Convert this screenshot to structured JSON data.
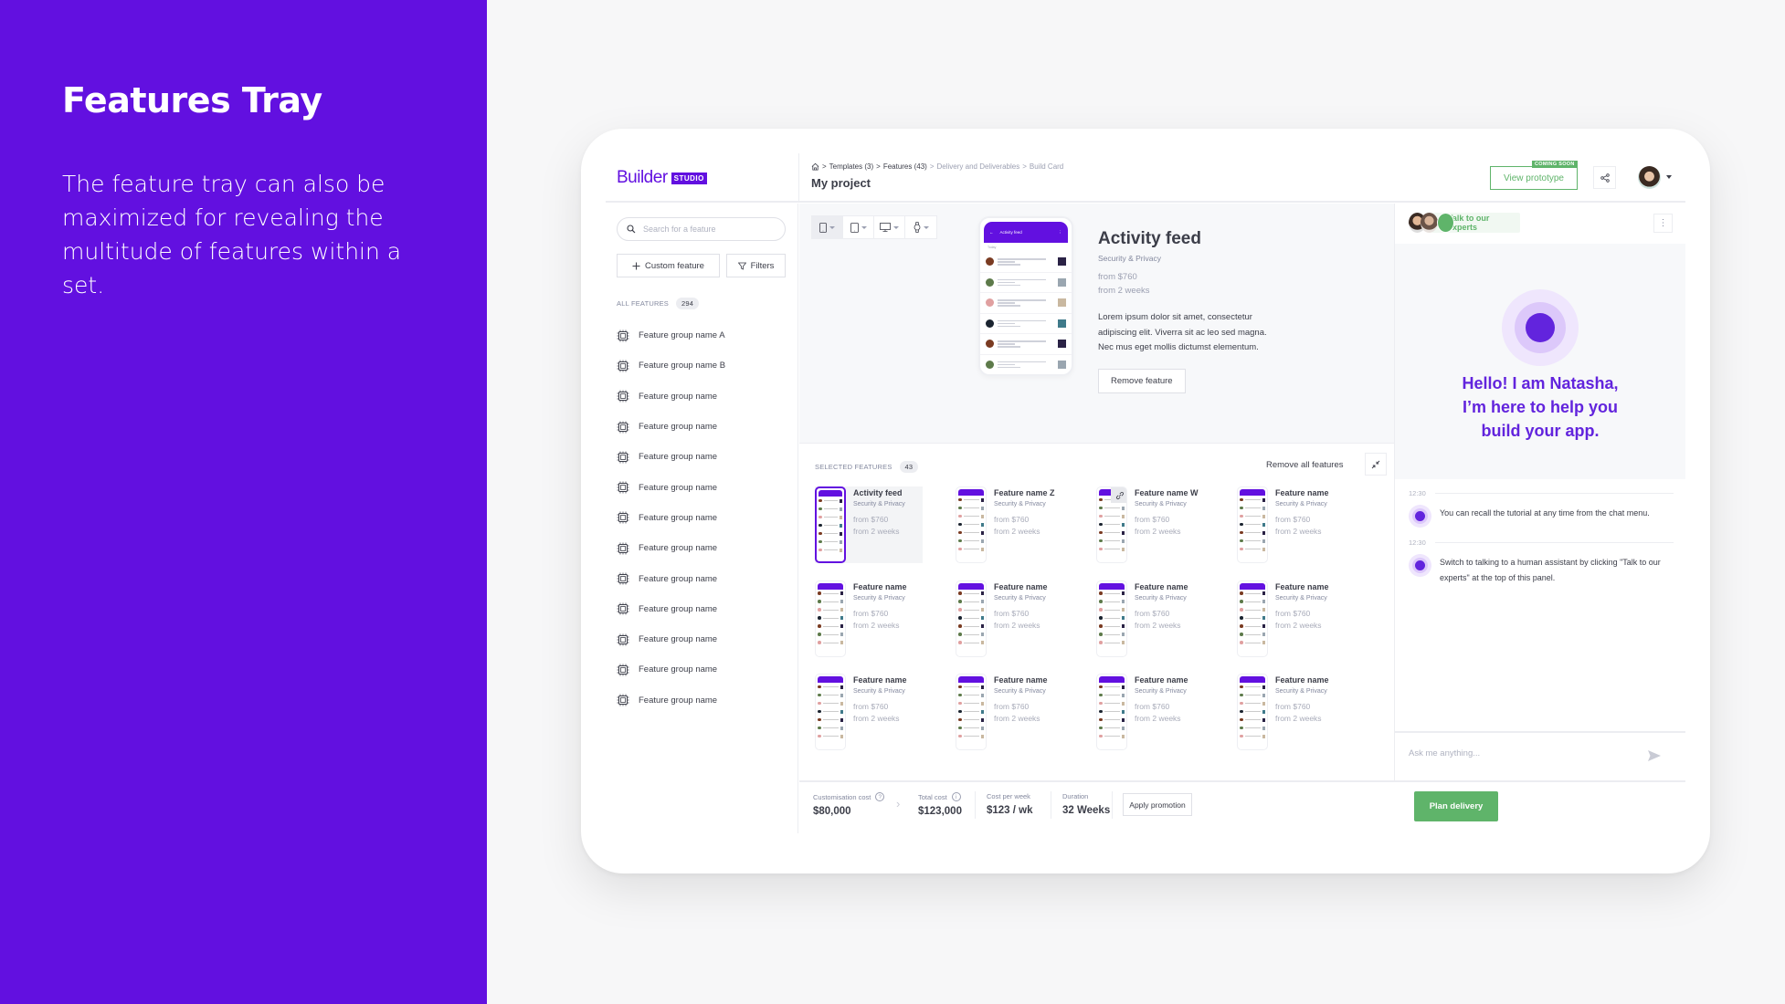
{
  "slide": {
    "title": "Features Tray",
    "description": "The feature tray can also be maximized for revealing the multitude of features within a set.",
    "accent": "#6210e0"
  },
  "app": {
    "logo": {
      "word": "Builder",
      "badge": "STUDIO"
    },
    "breadcrumb": {
      "home_icon": "home-icon",
      "items": [
        {
          "label": "Templates (3)",
          "active": true
        },
        {
          "label": "Features (43)",
          "active": true
        },
        {
          "label": "Delivery and Deliverables",
          "active": false
        },
        {
          "label": "Build Card",
          "active": false
        }
      ],
      "separator": ">"
    },
    "project_title": "My project",
    "header": {
      "view_prototype": "View prototype",
      "coming_soon": "COMING SOON",
      "share_icon": "share-icon"
    }
  },
  "sidebar": {
    "search_placeholder": "Search for a feature",
    "custom_feature": "Custom feature",
    "filters": "Filters",
    "all_features_label": "ALL FEATURES",
    "all_features_count": "294",
    "groups": [
      "Feature group name A",
      "Feature group name B",
      "Feature group name",
      "Feature group name",
      "Feature group name",
      "Feature group name",
      "Feature group name",
      "Feature group name",
      "Feature group name",
      "Feature group name",
      "Feature group name",
      "Feature group name",
      "Feature group name"
    ]
  },
  "preview": {
    "device_toggles": [
      {
        "icon": "mobile-icon",
        "active": true
      },
      {
        "icon": "tablet-icon",
        "active": false
      },
      {
        "icon": "desktop-icon",
        "active": false
      },
      {
        "icon": "watch-icon",
        "active": false
      }
    ],
    "phone_screen_title": "Activity feed",
    "phone_today": "Today",
    "feature": {
      "title": "Activity feed",
      "category": "Security & Privacy",
      "price": "from $760",
      "duration": "from 2 weeks",
      "description": "Lorem ipsum dolor sit amet, consectetur adipiscing elit. Viverra sit ac leo sed magna. Nec mus eget mollis dictumst elementum.",
      "remove_label": "Remove feature"
    }
  },
  "selected": {
    "label": "SELECTED FEATURES",
    "count": "43",
    "remove_all": "Remove all features",
    "cards": [
      {
        "name": "Activity feed",
        "category": "Security & Privacy",
        "price": "from $760",
        "duration": "from 2 weeks",
        "selected": true,
        "linked": false
      },
      {
        "name": "Feature name Z",
        "category": "Security & Privacy",
        "price": "from $760",
        "duration": "from 2 weeks",
        "selected": false,
        "linked": false
      },
      {
        "name": "Feature name W",
        "category": "Security & Privacy",
        "price": "from $760",
        "duration": "from 2 weeks",
        "selected": false,
        "linked": true
      },
      {
        "name": "Feature name",
        "category": "Security & Privacy",
        "price": "from $760",
        "duration": "from 2 weeks",
        "selected": false,
        "linked": false
      },
      {
        "name": "Feature name",
        "category": "Security & Privacy",
        "price": "from $760",
        "duration": "from 2 weeks",
        "selected": false,
        "linked": false
      },
      {
        "name": "Feature name",
        "category": "Security & Privacy",
        "price": "from $760",
        "duration": "from 2 weeks",
        "selected": false,
        "linked": false
      },
      {
        "name": "Feature name",
        "category": "Security & Privacy",
        "price": "from $760",
        "duration": "from 2 weeks",
        "selected": false,
        "linked": false
      },
      {
        "name": "Feature name",
        "category": "Security & Privacy",
        "price": "from $760",
        "duration": "from 2 weeks",
        "selected": false,
        "linked": false
      },
      {
        "name": "Feature name",
        "category": "Security & Privacy",
        "price": "from $760",
        "duration": "from 2 weeks",
        "selected": false,
        "linked": false
      },
      {
        "name": "Feature name",
        "category": "Security & Privacy",
        "price": "from $760",
        "duration": "from 2 weeks",
        "selected": false,
        "linked": false
      },
      {
        "name": "Feature name",
        "category": "Security & Privacy",
        "price": "from $760",
        "duration": "from 2 weeks",
        "selected": false,
        "linked": false
      },
      {
        "name": "Feature name",
        "category": "Security & Privacy",
        "price": "from $760",
        "duration": "from 2 weeks",
        "selected": false,
        "linked": false
      }
    ]
  },
  "footer": {
    "customisation_label": "Customisation cost",
    "customisation_value": "$80,000",
    "total_label": "Total cost",
    "total_value": "$123,000",
    "per_week_label": "Cost per week",
    "per_week_value": "$123 / wk",
    "duration_label": "Duration",
    "duration_value": "32 Weeks",
    "apply_promotion": "Apply promotion",
    "plan_delivery": "Plan delivery",
    "green": "#5fb46a"
  },
  "chat": {
    "talk_experts": "Talk to our experts",
    "greeting": "Hello! I am Natasha, I’m here to help you build your app.",
    "messages": [
      {
        "time": "12:30",
        "text": "You can recall the tutorial at any time from the chat menu."
      },
      {
        "time": "12:30",
        "text": "Switch to talking to a human assistant by clicking \"Talk to our experts\" at the top of this panel."
      }
    ],
    "input_placeholder": "Ask me anything..."
  }
}
